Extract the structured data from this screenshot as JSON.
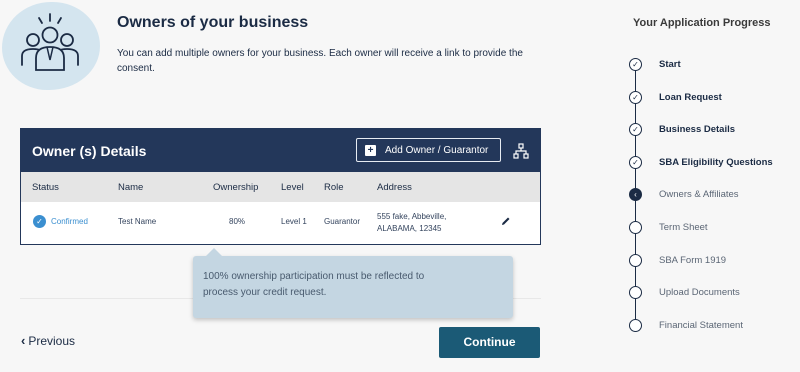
{
  "header": {
    "title": "Owners of your business",
    "intro": "You can add multiple owners for your business. Each owner will receive a link to provide the consent."
  },
  "owners_card": {
    "title": "Owner (s) Details",
    "add_button_label": "Add Owner / Guarantor",
    "columns": [
      "Status",
      "Name",
      "Ownership",
      "Level",
      "Role",
      "Address"
    ],
    "rows": [
      {
        "status": "Confirmed",
        "name": "Test Name",
        "ownership": "80%",
        "level": "Level 1",
        "role": "Guarantor",
        "address_line1": "555 fake, Abbeville,",
        "address_line2": "ALABAMA, 12345"
      }
    ]
  },
  "tooltip": {
    "line1": "100% ownership participation must be reflected to",
    "line2": "process your credit request."
  },
  "nav": {
    "previous_label": "Previous",
    "continue_label": "Continue"
  },
  "progress": {
    "title": "Your Application Progress",
    "steps": [
      {
        "label": "Start",
        "state": "done"
      },
      {
        "label": "Loan Request",
        "state": "done"
      },
      {
        "label": "Business Details",
        "state": "done"
      },
      {
        "label": "SBA Eligibility Questions",
        "state": "done"
      },
      {
        "label": "Owners & Affiliates",
        "state": "current"
      },
      {
        "label": "Term Sheet",
        "state": "pending"
      },
      {
        "label": "SBA Form 1919",
        "state": "pending"
      },
      {
        "label": "Upload Documents",
        "state": "pending"
      },
      {
        "label": "Financial Statement",
        "state": "pending"
      }
    ]
  },
  "colors": {
    "navy": "#23375a",
    "accent_blue": "#3b8fd0",
    "continue_teal": "#1b5a76",
    "tooltip_bg": "#c4d6e2"
  },
  "icons": [
    "team-icon",
    "plus-icon",
    "org-chart-icon",
    "check-circle-icon",
    "pencil-icon",
    "chevron-left-icon",
    "step-check-icon",
    "chevron-left-current-icon"
  ]
}
